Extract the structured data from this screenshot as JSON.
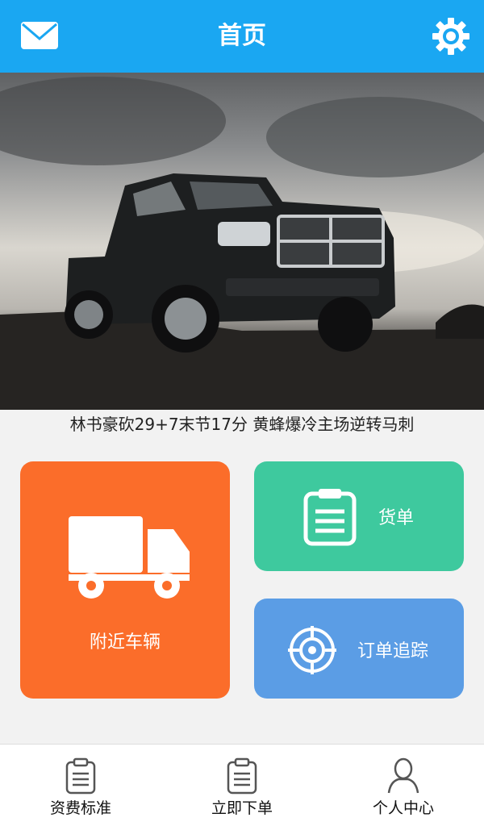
{
  "header": {
    "title": "首页",
    "left_icon": "mail-icon",
    "right_icon": "gear-icon",
    "color": "#1aa7f2"
  },
  "banner": {
    "ticker_text": "林书豪砍29+7末节17分 黄蜂爆冷主场逆转马刺"
  },
  "tiles": {
    "nearby": {
      "label": "附近车辆",
      "icon": "truck-icon",
      "color": "#fb6d2a"
    },
    "orders": {
      "label": "货单",
      "icon": "clipboard-icon",
      "color": "#3ec99e"
    },
    "track": {
      "label": "订单追踪",
      "icon": "target-icon",
      "color": "#5b9de5"
    }
  },
  "tabbar": {
    "items": [
      {
        "label": "资费标准",
        "icon": "clipboard-icon"
      },
      {
        "label": "立即下单",
        "icon": "clipboard-icon"
      },
      {
        "label": "个人中心",
        "icon": "user-icon"
      }
    ]
  }
}
